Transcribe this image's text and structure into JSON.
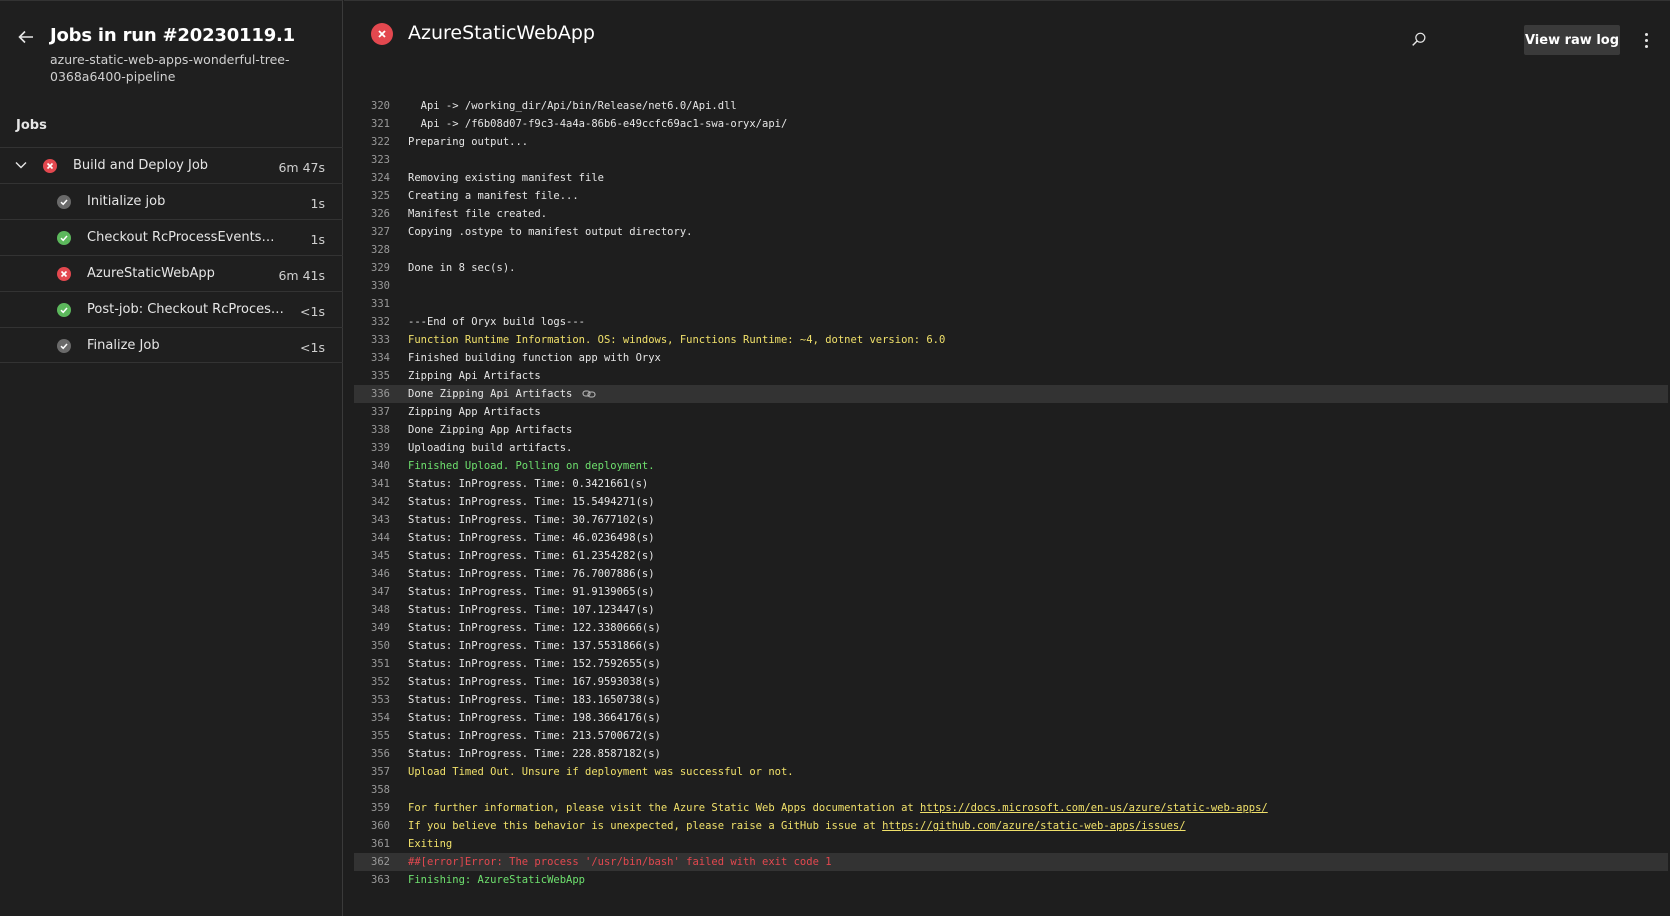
{
  "sidebar": {
    "run_title": "Jobs in run #20230119.1",
    "run_subtitle": "azure-static-web-apps-wonderful-tree-0368a6400-pipeline",
    "jobs_heading": "Jobs",
    "jobs": [
      {
        "label": "Build and Deploy Job",
        "duration": "6m 47s",
        "status": "failed"
      },
      {
        "label": "Initialize job",
        "duration": "1s",
        "status": "skipped"
      },
      {
        "label": "Checkout RcProcessEvents@featu...",
        "duration": "1s",
        "status": "succeeded"
      },
      {
        "label": "AzureStaticWebApp",
        "duration": "6m 41s",
        "status": "failed"
      },
      {
        "label": "Post-job: Checkout RcProcessEv...",
        "duration": "<1s",
        "status": "succeeded"
      },
      {
        "label": "Finalize Job",
        "duration": "<1s",
        "status": "skipped"
      }
    ]
  },
  "main": {
    "title": "AzureStaticWebApp",
    "raw_log_label": "View raw log"
  },
  "colors": {
    "fail": "#e3484f",
    "success": "#5cb85c",
    "neutral": "#6a6a6a",
    "log_yellow": "#f0e06a",
    "log_green": "#6ee06e"
  },
  "log": [
    {
      "n": "320",
      "t": "  Api -> /working_dir/Api/bin/Release/net6.0/Api.dll"
    },
    {
      "n": "321",
      "t": "  Api -> /f6b08d07-f9c3-4a4a-86b6-e49ccfc69ac1-swa-oryx/api/"
    },
    {
      "n": "322",
      "t": "Preparing output..."
    },
    {
      "n": "323",
      "t": ""
    },
    {
      "n": "324",
      "t": "Removing existing manifest file"
    },
    {
      "n": "325",
      "t": "Creating a manifest file..."
    },
    {
      "n": "326",
      "t": "Manifest file created."
    },
    {
      "n": "327",
      "t": "Copying .ostype to manifest output directory."
    },
    {
      "n": "328",
      "t": ""
    },
    {
      "n": "329",
      "t": "Done in 8 sec(s)."
    },
    {
      "n": "330",
      "t": ""
    },
    {
      "n": "331",
      "t": ""
    },
    {
      "n": "332",
      "t": "---End of Oryx build logs---"
    },
    {
      "n": "333",
      "t": "Function Runtime Information. OS: windows, Functions Runtime: ~4, dotnet version: 6.0",
      "c": "yellow"
    },
    {
      "n": "334",
      "t": "Finished building function app with Oryx"
    },
    {
      "n": "335",
      "t": "Zipping Api Artifacts"
    },
    {
      "n": "336",
      "t": "Done Zipping Api Artifacts",
      "hl": true,
      "icon": true
    },
    {
      "n": "337",
      "t": "Zipping App Artifacts"
    },
    {
      "n": "338",
      "t": "Done Zipping App Artifacts"
    },
    {
      "n": "339",
      "t": "Uploading build artifacts."
    },
    {
      "n": "340",
      "t": "Finished Upload. Polling on deployment.",
      "c": "green"
    },
    {
      "n": "341",
      "t": "Status: InProgress. Time: 0.3421661(s)"
    },
    {
      "n": "342",
      "t": "Status: InProgress. Time: 15.5494271(s)"
    },
    {
      "n": "343",
      "t": "Status: InProgress. Time: 30.7677102(s)"
    },
    {
      "n": "344",
      "t": "Status: InProgress. Time: 46.0236498(s)"
    },
    {
      "n": "345",
      "t": "Status: InProgress. Time: 61.2354282(s)"
    },
    {
      "n": "346",
      "t": "Status: InProgress. Time: 76.7007886(s)"
    },
    {
      "n": "347",
      "t": "Status: InProgress. Time: 91.9139065(s)"
    },
    {
      "n": "348",
      "t": "Status: InProgress. Time: 107.123447(s)"
    },
    {
      "n": "349",
      "t": "Status: InProgress. Time: 122.3380666(s)"
    },
    {
      "n": "350",
      "t": "Status: InProgress. Time: 137.5531866(s)"
    },
    {
      "n": "351",
      "t": "Status: InProgress. Time: 152.7592655(s)"
    },
    {
      "n": "352",
      "t": "Status: InProgress. Time: 167.9593038(s)"
    },
    {
      "n": "353",
      "t": "Status: InProgress. Time: 183.1650738(s)"
    },
    {
      "n": "354",
      "t": "Status: InProgress. Time: 198.3664176(s)"
    },
    {
      "n": "355",
      "t": "Status: InProgress. Time: 213.5700672(s)"
    },
    {
      "n": "356",
      "t": "Status: InProgress. Time: 228.8587182(s)"
    },
    {
      "n": "357",
      "t": "Upload Timed Out. Unsure if deployment was successful or not.",
      "c": "yellow"
    },
    {
      "n": "358",
      "t": ""
    },
    {
      "n": "359",
      "t": "For further information, please visit the Azure Static Web Apps documentation at ",
      "c": "yellow",
      "link": "https://docs.microsoft.com/en-us/azure/static-web-apps/"
    },
    {
      "n": "360",
      "t": "If you believe this behavior is unexpected, please raise a GitHub issue at ",
      "c": "yellow",
      "link": "https://github.com/azure/static-web-apps/issues/"
    },
    {
      "n": "361",
      "t": "Exiting",
      "c": "yellow"
    },
    {
      "n": "362",
      "t": "##[error]Error: The process '/usr/bin/bash' failed with exit code 1",
      "c": "red",
      "hl": true
    },
    {
      "n": "363",
      "t": "Finishing: AzureStaticWebApp",
      "c": "green"
    }
  ]
}
